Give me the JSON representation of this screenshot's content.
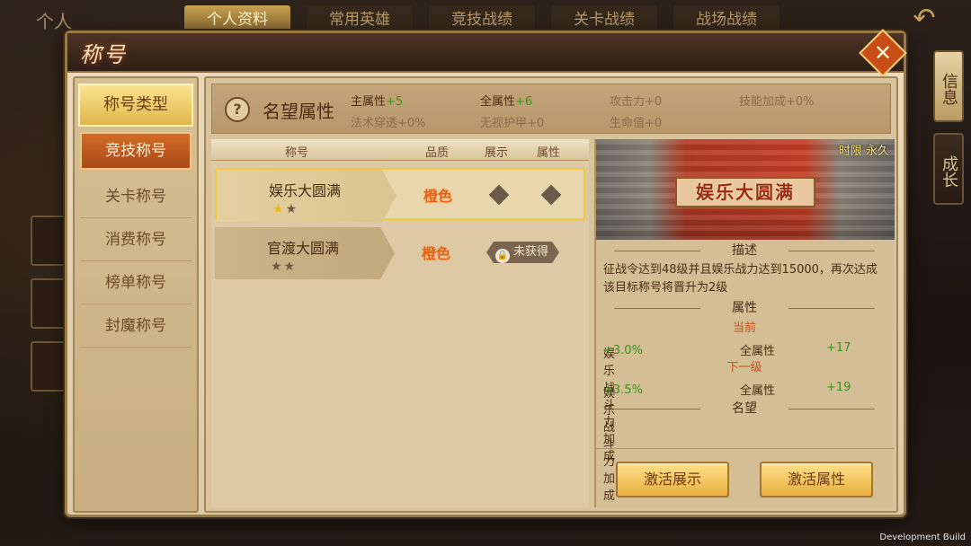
{
  "top_bar": {
    "left_label": "个人",
    "tabs": [
      {
        "label": "个人资料",
        "active": true
      },
      {
        "label": "常用英雄",
        "active": false
      },
      {
        "label": "竞技战绩",
        "active": false
      },
      {
        "label": "关卡战绩",
        "active": false
      },
      {
        "label": "战场战绩",
        "active": false
      }
    ],
    "back_icon": "back-arrow-icon"
  },
  "side_buttons": [
    "信息",
    "成长"
  ],
  "dialog": {
    "title": "称号",
    "close_icon": "close-icon",
    "categories": {
      "header": "称号类型",
      "items": [
        {
          "label": "竞技称号",
          "active": true
        },
        {
          "label": "关卡称号",
          "active": false
        },
        {
          "label": "消费称号",
          "active": false
        },
        {
          "label": "榜单称号",
          "active": false
        },
        {
          "label": "封魔称号",
          "active": false
        }
      ]
    },
    "fame": {
      "help_icon": "question-icon",
      "label": "名望属性",
      "stats": [
        {
          "name": "主属性",
          "value": "+5",
          "active": true
        },
        {
          "name": "全属性",
          "value": "+6",
          "active": true
        },
        {
          "name": "攻击力",
          "value": "+0",
          "active": false
        },
        {
          "name": "技能加成",
          "value": "+0%",
          "active": false
        },
        {
          "name": "法术穿透",
          "value": "+0%",
          "active": false
        },
        {
          "name": "无视护甲",
          "value": "+0",
          "active": false
        },
        {
          "name": "生命值",
          "value": "+0",
          "active": false
        }
      ]
    },
    "table": {
      "headers": [
        "称号",
        "品质",
        "展示",
        "属性"
      ],
      "rows": [
        {
          "name": "娱乐大圆满",
          "stars_on": 1,
          "stars_total": 2,
          "quality": "橙色",
          "owned": true,
          "selected": true
        },
        {
          "name": "官渡大圆满",
          "stars_on": 0,
          "stars_total": 2,
          "quality": "橙色",
          "owned": false,
          "status": "未获得",
          "selected": false
        }
      ]
    },
    "detail": {
      "banner_name": "娱乐大圆满",
      "time_limit": "时限 永久",
      "desc_title": "描述",
      "description": "征战令达到48级并且娱乐战力达到15000，再次达成该目标称号将晋升为2级",
      "attr_title": "属性",
      "current_label": "当前",
      "current": {
        "attr1_name": "娱乐战斗力加成",
        "attr1_value": "+3.0%",
        "attr2_name": "全属性",
        "attr2_value": "+17"
      },
      "next_label": "下一级",
      "next": {
        "attr1_name": "娱乐战斗力加成",
        "attr1_value": "+3.5%",
        "attr2_name": "全属性",
        "attr2_value": "+19"
      },
      "fame_title": "名望",
      "btn_show": "激活展示",
      "btn_attr": "激活属性"
    }
  },
  "dev_build": "Development Build"
}
